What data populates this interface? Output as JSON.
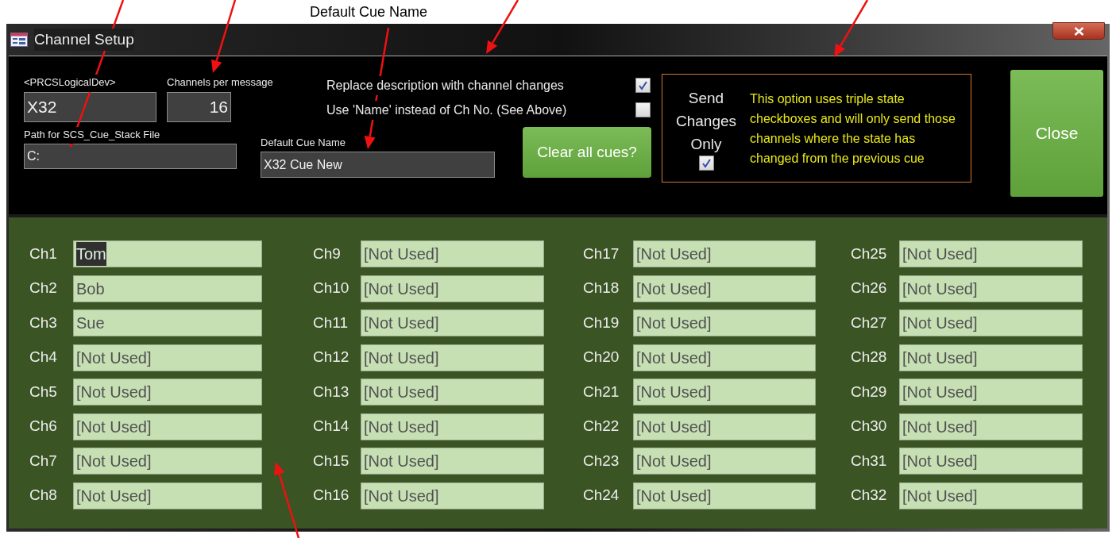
{
  "annotation": {
    "caption": "Default Cue Name"
  },
  "window": {
    "title": "Channel Setup"
  },
  "settings": {
    "logical_dev": {
      "label": "<PRCSLogicalDev>",
      "value": "X32"
    },
    "channels_per_message": {
      "label": "Channels per message",
      "value": "16"
    },
    "path": {
      "label": "Path for SCS_Cue_Stack File",
      "value": "C:"
    },
    "default_cue_name": {
      "label": "Default Cue Name",
      "value": "X32 Cue New"
    }
  },
  "options": [
    {
      "label": "Replace description with channel changes",
      "checked": true
    },
    {
      "label": "Use 'Name' instead of Ch No. (See Above)",
      "checked": false
    }
  ],
  "clear_button": "Clear all cues?",
  "send_changes": {
    "label": "Send Changes Only",
    "checked": true,
    "note": "This option uses triple state checkboxes and will only send those channels where the state has changed from the previous cue"
  },
  "close_button": "Close",
  "channels": [
    {
      "label": "Ch1",
      "value": "Tom",
      "text_selected": true
    },
    {
      "label": "Ch2",
      "value": "Bob",
      "text_selected": false
    },
    {
      "label": "Ch3",
      "value": "Sue",
      "text_selected": false
    },
    {
      "label": "Ch4",
      "value": "[Not Used]",
      "text_selected": false
    },
    {
      "label": "Ch5",
      "value": "[Not Used]",
      "text_selected": false
    },
    {
      "label": "Ch6",
      "value": "[Not Used]",
      "text_selected": false
    },
    {
      "label": "Ch7",
      "value": "[Not Used]",
      "text_selected": false
    },
    {
      "label": "Ch8",
      "value": "[Not Used]",
      "text_selected": false
    },
    {
      "label": "Ch9",
      "value": "[Not Used]",
      "text_selected": false
    },
    {
      "label": "Ch10",
      "value": "[Not Used]",
      "text_selected": false
    },
    {
      "label": "Ch11",
      "value": "[Not Used]",
      "text_selected": false
    },
    {
      "label": "Ch12",
      "value": "[Not Used]",
      "text_selected": false
    },
    {
      "label": "Ch13",
      "value": "[Not Used]",
      "text_selected": false
    },
    {
      "label": "Ch14",
      "value": "[Not Used]",
      "text_selected": false
    },
    {
      "label": "Ch15",
      "value": "[Not Used]",
      "text_selected": false
    },
    {
      "label": "Ch16",
      "value": "[Not Used]",
      "text_selected": false
    },
    {
      "label": "Ch17",
      "value": "[Not Used]",
      "text_selected": false
    },
    {
      "label": "Ch18",
      "value": "[Not Used]",
      "text_selected": false
    },
    {
      "label": "Ch19",
      "value": "[Not Used]",
      "text_selected": false
    },
    {
      "label": "Ch20",
      "value": "[Not Used]",
      "text_selected": false
    },
    {
      "label": "Ch21",
      "value": "[Not Used]",
      "text_selected": false
    },
    {
      "label": "Ch22",
      "value": "[Not Used]",
      "text_selected": false
    },
    {
      "label": "Ch23",
      "value": "[Not Used]",
      "text_selected": false
    },
    {
      "label": "Ch24",
      "value": "[Not Used]",
      "text_selected": false
    },
    {
      "label": "Ch25",
      "value": "[Not Used]",
      "text_selected": false
    },
    {
      "label": "Ch26",
      "value": "[Not Used]",
      "text_selected": false
    },
    {
      "label": "Ch27",
      "value": "[Not Used]",
      "text_selected": false
    },
    {
      "label": "Ch28",
      "value": "[Not Used]",
      "text_selected": false
    },
    {
      "label": "Ch29",
      "value": "[Not Used]",
      "text_selected": false
    },
    {
      "label": "Ch30",
      "value": "[Not Used]",
      "text_selected": false
    },
    {
      "label": "Ch31",
      "value": "[Not Used]",
      "text_selected": false
    },
    {
      "label": "Ch32",
      "value": "[Not Used]",
      "text_selected": false
    }
  ]
}
